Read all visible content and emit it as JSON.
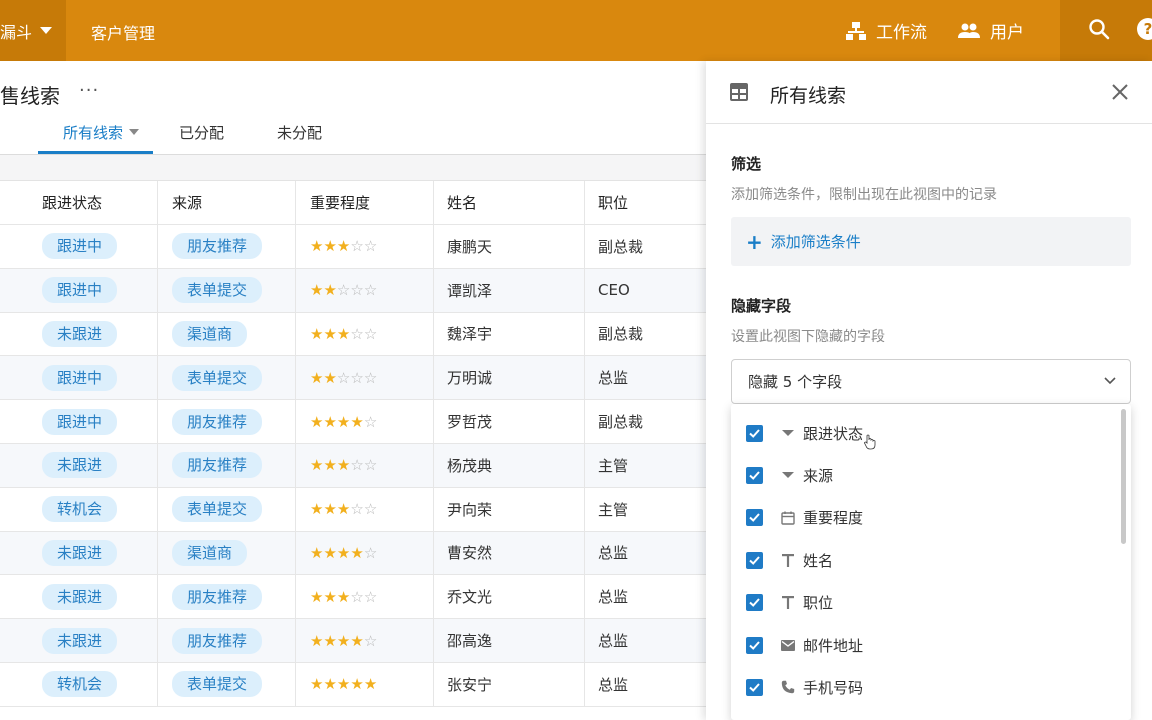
{
  "topbar": {
    "app_name": "漏斗",
    "nav_title": "客户管理",
    "workflow_label": "工作流",
    "users_label": "用户",
    "help_label": "?",
    "colors": {
      "bar": "#D9880E",
      "dark": "#C67A08"
    }
  },
  "page": {
    "title": "售线索",
    "more": "···",
    "tabs": [
      {
        "label": "所有线索",
        "active": true
      },
      {
        "label": "已分配",
        "active": false
      },
      {
        "label": "未分配",
        "active": false
      }
    ]
  },
  "table": {
    "columns": [
      "跟进状态",
      "来源",
      "重要程度",
      "姓名",
      "职位"
    ],
    "rows": [
      {
        "status": "跟进中",
        "source": "朋友推荐",
        "rating": 3,
        "name": "康鹏天",
        "title": "副总裁"
      },
      {
        "status": "跟进中",
        "source": "表单提交",
        "rating": 2,
        "name": "谭凯泽",
        "title": "CEO"
      },
      {
        "status": "未跟进",
        "source": "渠道商",
        "rating": 3,
        "name": "魏泽宇",
        "title": "副总裁"
      },
      {
        "status": "跟进中",
        "source": "表单提交",
        "rating": 2,
        "name": "万明诚",
        "title": "总监"
      },
      {
        "status": "跟进中",
        "source": "朋友推荐",
        "rating": 4,
        "name": "罗哲茂",
        "title": "副总裁"
      },
      {
        "status": "未跟进",
        "source": "朋友推荐",
        "rating": 3,
        "name": "杨茂典",
        "title": "主管"
      },
      {
        "status": "转机会",
        "source": "表单提交",
        "rating": 3,
        "name": "尹向荣",
        "title": "主管"
      },
      {
        "status": "未跟进",
        "source": "渠道商",
        "rating": 4,
        "name": "曹安然",
        "title": "总监"
      },
      {
        "status": "未跟进",
        "source": "朋友推荐",
        "rating": 3,
        "name": "乔文光",
        "title": "总监"
      },
      {
        "status": "未跟进",
        "source": "朋友推荐",
        "rating": 4,
        "name": "邵高逸",
        "title": "总监"
      },
      {
        "status": "转机会",
        "source": "表单提交",
        "rating": 5,
        "name": "张安宁",
        "title": "总监"
      }
    ],
    "max_rating": 5
  },
  "panel": {
    "title": "所有线索",
    "filter": {
      "title": "筛选",
      "desc": "添加筛选条件，限制出现在此视图中的记录",
      "add_label": "添加筛选条件"
    },
    "hidden": {
      "title": "隐藏字段",
      "desc": "设置此视图下隐藏的字段",
      "select_value": "隐藏 5 个字段"
    },
    "fields": [
      {
        "label": "跟进状态",
        "icon": "dropdown-caret-icon",
        "checked": true
      },
      {
        "label": "来源",
        "icon": "dropdown-caret-icon",
        "checked": true
      },
      {
        "label": "重要程度",
        "icon": "calendar-icon",
        "checked": true
      },
      {
        "label": "姓名",
        "icon": "text-icon",
        "checked": true
      },
      {
        "label": "职位",
        "icon": "text-icon",
        "checked": true
      },
      {
        "label": "邮件地址",
        "icon": "mail-icon",
        "checked": true
      },
      {
        "label": "手机号码",
        "icon": "phone-icon",
        "checked": true
      }
    ]
  }
}
